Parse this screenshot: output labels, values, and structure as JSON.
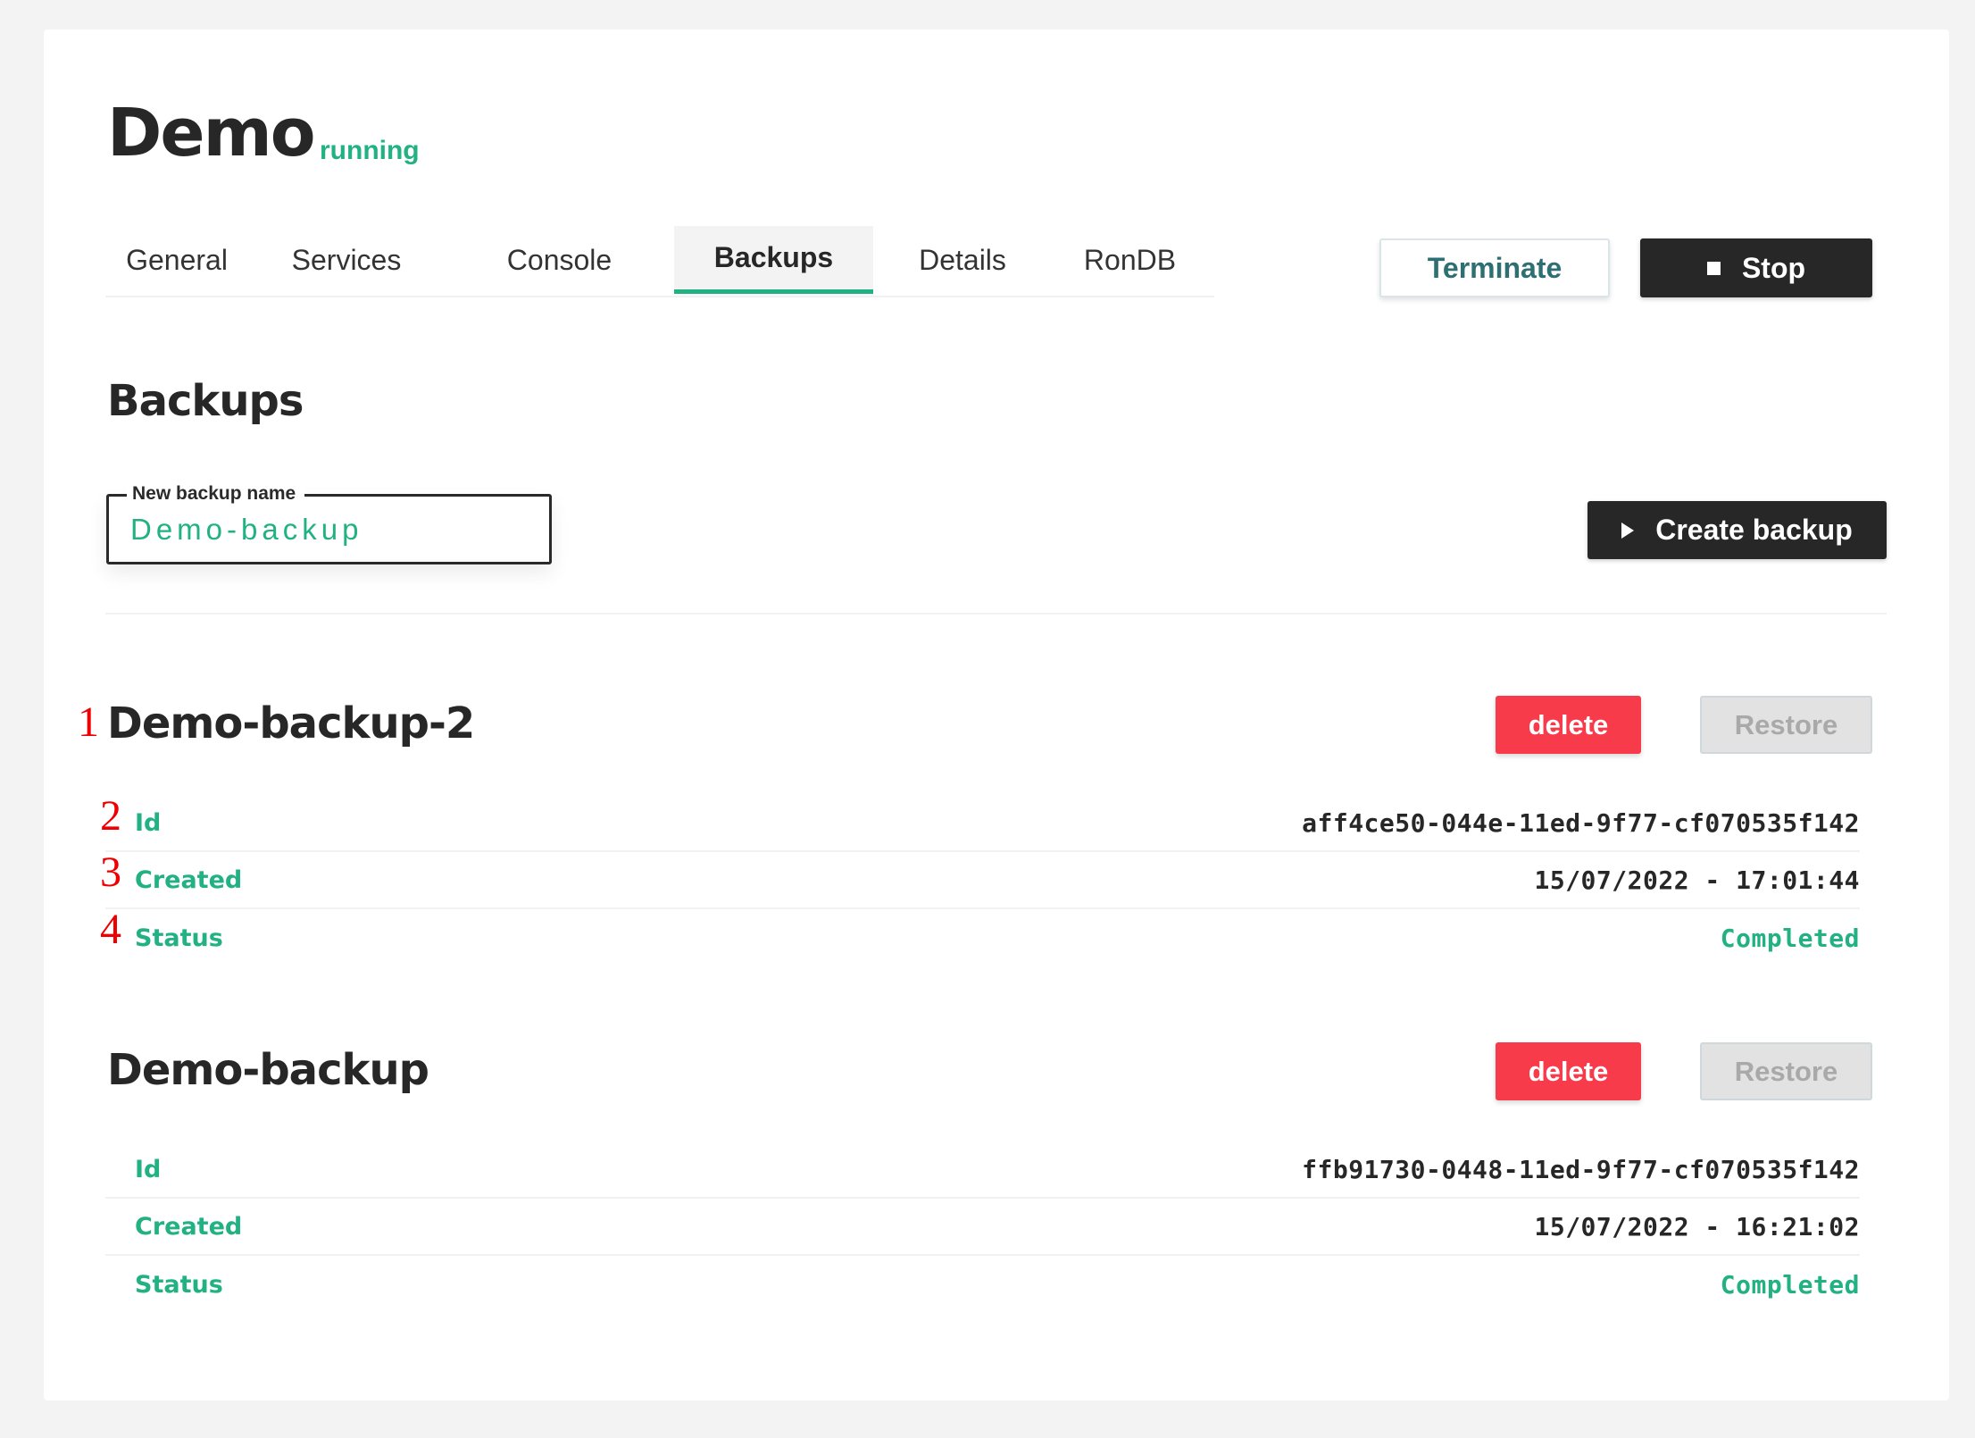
{
  "header": {
    "title": "Demo",
    "status": "running"
  },
  "tabs": [
    {
      "label": "General",
      "active": false
    },
    {
      "label": "Services",
      "active": false
    },
    {
      "label": "Console",
      "active": false
    },
    {
      "label": "Backups",
      "active": true
    },
    {
      "label": "Details",
      "active": false
    },
    {
      "label": "RonDB",
      "active": false
    }
  ],
  "actions": {
    "terminate_label": "Terminate",
    "stop_label": "Stop",
    "stop_icon": "stop-square-icon"
  },
  "section": {
    "title": "Backups",
    "new_backup_field": {
      "label": "New backup name",
      "value": "Demo-backup"
    },
    "create_label": "Create backup",
    "create_icon": "play-triangle-icon"
  },
  "backups": [
    {
      "name": "Demo-backup-2",
      "delete_label": "delete",
      "restore_label": "Restore",
      "rows": [
        {
          "key": "Id",
          "value": "aff4ce50-044e-11ed-9f77-cf070535f142"
        },
        {
          "key": "Created",
          "value": "15/07/2022 - 17:01:44"
        },
        {
          "key": "Status",
          "value": "Completed"
        }
      ]
    },
    {
      "name": "Demo-backup",
      "delete_label": "delete",
      "restore_label": "Restore",
      "rows": [
        {
          "key": "Id",
          "value": "ffb91730-0448-11ed-9f77-cf070535f142"
        },
        {
          "key": "Created",
          "value": "15/07/2022 - 16:21:02"
        },
        {
          "key": "Status",
          "value": "Completed"
        }
      ]
    }
  ],
  "annotations": [
    "1",
    "2",
    "3",
    "4"
  ],
  "colors": {
    "accent": "#21b182",
    "danger": "#f73b4a",
    "dark": "#272727",
    "background": "#f3f3f3"
  }
}
